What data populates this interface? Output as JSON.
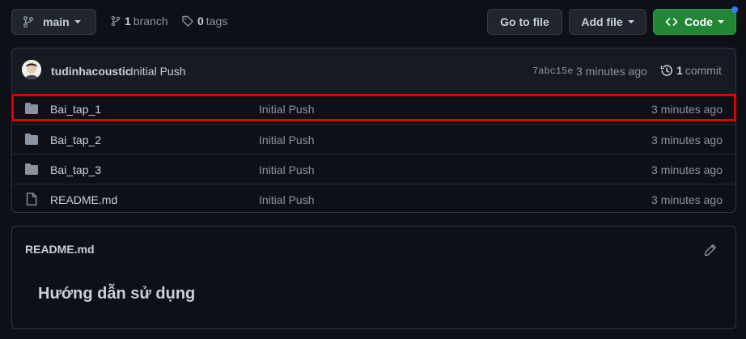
{
  "branch_button": {
    "label": "main"
  },
  "branches": {
    "count": "1",
    "label": "branch"
  },
  "tags": {
    "count": "0",
    "label": "tags"
  },
  "actions": {
    "go_to_file": "Go to file",
    "add_file": "Add file",
    "code": "Code"
  },
  "commit": {
    "author": "tudinhacoustic",
    "message": "Initial Push",
    "hash": "7abc15e",
    "time": "3 minutes ago",
    "count": "1",
    "count_label": "commit"
  },
  "files": [
    {
      "type": "folder",
      "name": "Bai_tap_1",
      "message": "Initial Push",
      "age": "3 minutes ago",
      "highlighted": true
    },
    {
      "type": "folder",
      "name": "Bai_tap_2",
      "message": "Initial Push",
      "age": "3 minutes ago"
    },
    {
      "type": "folder",
      "name": "Bai_tap_3",
      "message": "Initial Push",
      "age": "3 minutes ago"
    },
    {
      "type": "file",
      "name": "README.md",
      "message": "Initial Push",
      "age": "3 minutes ago"
    }
  ],
  "readme": {
    "title": "README.md",
    "heading": "Hướng dẫn sử dụng"
  },
  "colors": {
    "background": "#0d1117",
    "code_button": "#238636",
    "highlight": "#e00000",
    "folder_icon": "#8b949e",
    "notification_dot": "#1f6feb"
  }
}
